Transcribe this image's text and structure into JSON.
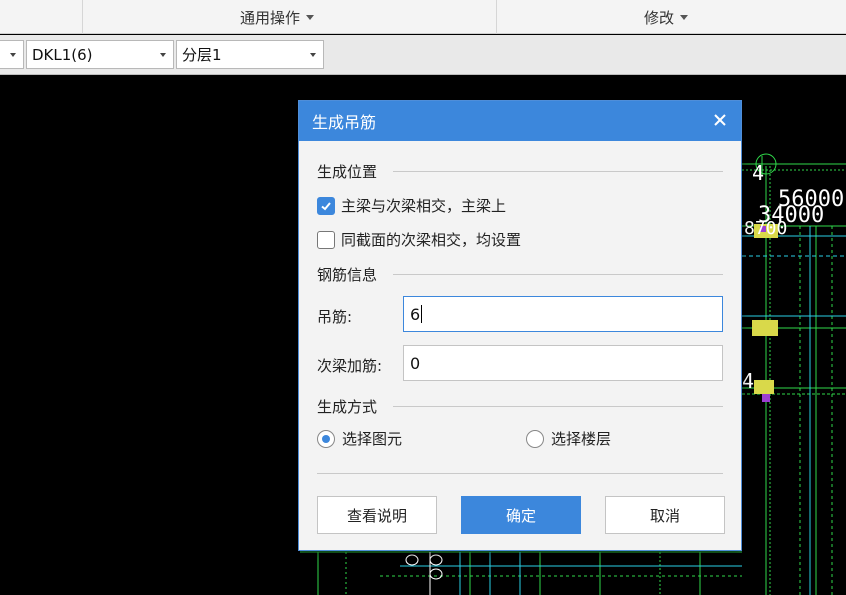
{
  "ribbon": {
    "groups": [
      {
        "label": "通用操作"
      },
      {
        "label": "修改"
      }
    ]
  },
  "toolbar": {
    "combo1": "",
    "combo2": "DKL1(6)",
    "combo3": "分层1"
  },
  "canvas": {
    "labels": [
      "4",
      "56000",
      "34000",
      "8700",
      "4"
    ]
  },
  "dialog": {
    "title": "生成吊筋",
    "sections": {
      "position": "生成位置",
      "rebar": "钢筋信息",
      "method": "生成方式"
    },
    "options": {
      "main_beam": {
        "label": "主梁与次梁相交，主梁上",
        "checked": true
      },
      "same_section": {
        "label": "同截面的次梁相交，均设置",
        "checked": false
      }
    },
    "fields": {
      "hanger": {
        "label": "吊筋:",
        "value": "6"
      },
      "secondary": {
        "label": "次梁加筋:",
        "value": "0"
      }
    },
    "radios": {
      "element": {
        "label": "选择图元",
        "selected": true
      },
      "floor": {
        "label": "选择楼层",
        "selected": false
      }
    },
    "buttons": {
      "help": "查看说明",
      "ok": "确定",
      "cancel": "取消"
    }
  },
  "colors": {
    "accent": "#3c87dc",
    "cad_green": "#2fd94a",
    "cad_cyan": "#2ad0e6",
    "cad_yellow": "#d9d94a"
  }
}
